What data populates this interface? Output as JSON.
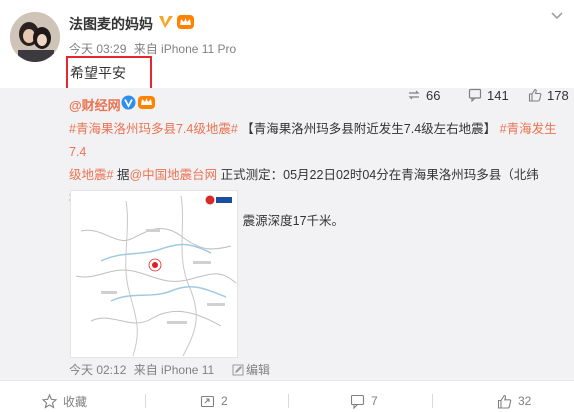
{
  "post": {
    "author": "法图麦的妈妈",
    "time": "今天 03:29",
    "source": "来自 iPhone 11 Pro",
    "text": "希望平安"
  },
  "repost": {
    "author": "@财经网",
    "topic1": "#青海果洛州玛多县7.4级地震#",
    "headline": "【青海果洛州玛多县附近发生7.4级左右地震】",
    "topic2a": "#青海发生7.4",
    "topic2b": "级地震#",
    "via_prefix": "据",
    "via_link": "@中国地震台网",
    "line2_rest": "正式测定：05月22日02时04分在青海果洛州玛多县（北纬34.59度，",
    "line3": "东经98.34度）发生7.4级地震，震源深度17千米。",
    "time": "今天 02:12",
    "source": "来自 iPhone 11",
    "edit_label": "编辑",
    "repost_count": "66",
    "comment_count": "141",
    "like_count": "178"
  },
  "actions": {
    "favorite_label": "收藏",
    "repost_count": "2",
    "comment_count": "7",
    "like_count": "32"
  },
  "colors": {
    "link": "#eb7350",
    "highlight": "#e8262d",
    "repost_bg": "#f2f2f5"
  }
}
